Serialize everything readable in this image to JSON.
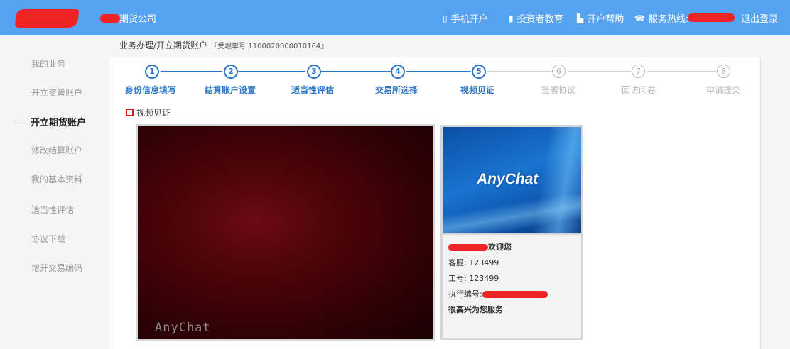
{
  "header": {
    "brand": "期货公司",
    "nav": [
      {
        "icon": "phone-icon",
        "glyph": "▯",
        "label": "手机开户"
      },
      {
        "icon": "books-icon",
        "glyph": "▮",
        "label": "投资者教育"
      },
      {
        "icon": "save-icon",
        "glyph": "▙",
        "label": "开户帮助"
      },
      {
        "icon": "telephone-icon",
        "glyph": "☎",
        "label": "服务热线:"
      }
    ],
    "logout": "退出登录"
  },
  "breadcrumb": {
    "path": "业务办理/开立期货账户",
    "sub": "『受理单号:1100020000010164』"
  },
  "sidebar": {
    "items": [
      {
        "label": "我的业务",
        "active": false
      },
      {
        "label": "开立资管账户",
        "active": false
      },
      {
        "label": "开立期货账户",
        "active": true
      },
      {
        "label": "修改结算账户",
        "active": false
      },
      {
        "label": "我的基本资料",
        "active": false
      },
      {
        "label": "适当性评估",
        "active": false
      },
      {
        "label": "协议下载",
        "active": false
      },
      {
        "label": "增开交易编码",
        "active": false
      }
    ]
  },
  "steps": [
    {
      "num": "1",
      "label": "身份信息填写",
      "done": true
    },
    {
      "num": "2",
      "label": "结算账户设置",
      "done": true
    },
    {
      "num": "3",
      "label": "适当性评估",
      "done": true
    },
    {
      "num": "4",
      "label": "交易所选择",
      "done": true
    },
    {
      "num": "5",
      "label": "视频见证",
      "done": true
    },
    {
      "num": "6",
      "label": "签署协议",
      "done": false
    },
    {
      "num": "7",
      "label": "回访问卷",
      "done": false
    },
    {
      "num": "8",
      "label": "申请提交",
      "done": false
    }
  ],
  "section_title": "视频见证",
  "video": {
    "watermark": "AnyChat"
  },
  "agent": {
    "logo": "AnyChat",
    "welcome": "欢迎您",
    "service_label": "客服:",
    "service_value": "123499",
    "staff_label": "工号:",
    "staff_value": "123499",
    "exec_label": "执行编号:",
    "greeting": "很高兴为您服务"
  },
  "colors": {
    "header_bg": "#56a3f2",
    "step_active": "#2e77c9",
    "step_inactive": "#b5b5b5",
    "redaction": "#ee2323"
  }
}
